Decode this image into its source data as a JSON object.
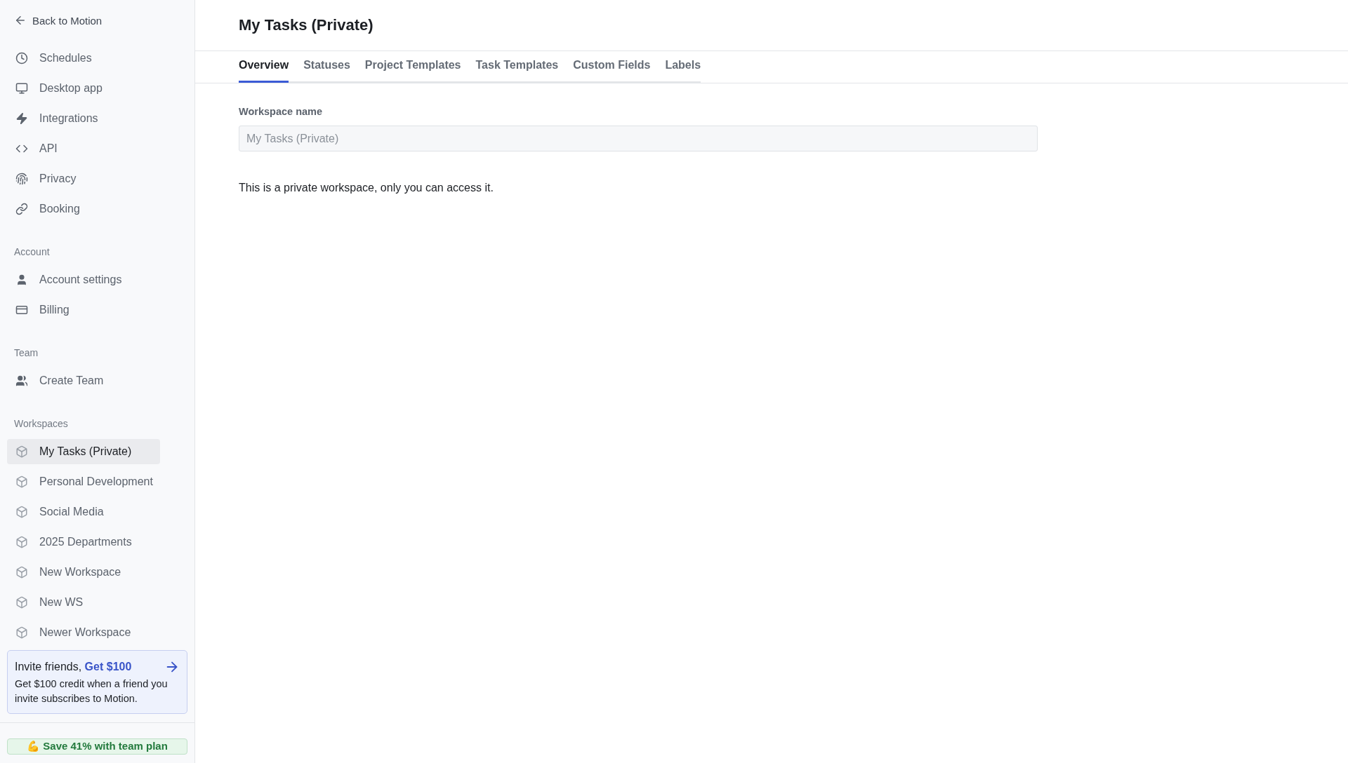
{
  "sidebar": {
    "back_link": "Back to Motion",
    "items": [
      {
        "label": "Schedules"
      },
      {
        "label": "Desktop app"
      },
      {
        "label": "Integrations"
      },
      {
        "label": "API"
      },
      {
        "label": "Privacy"
      },
      {
        "label": "Booking"
      }
    ],
    "sections": [
      {
        "title": "Account",
        "items": [
          {
            "label": "Account settings",
            "selected": false
          },
          {
            "label": "Billing",
            "selected": false
          }
        ]
      },
      {
        "title": "Team",
        "items": [
          {
            "label": "Create Team",
            "selected": false
          }
        ]
      },
      {
        "title": "Workspaces",
        "items": [
          {
            "label": "My Tasks (Private)",
            "selected": true
          },
          {
            "label": "Personal Development",
            "selected": false
          },
          {
            "label": "Social Media",
            "selected": false
          },
          {
            "label": "2025 Departments",
            "selected": false
          },
          {
            "label": "New Workspace",
            "selected": false
          },
          {
            "label": "New WS",
            "selected": false
          },
          {
            "label": "Newer Workspace",
            "selected": false
          }
        ]
      }
    ],
    "invite": {
      "title": "Invite friends, **Get $100**",
      "text": "Get $100 credit when a friend you invite subscribes to Motion."
    },
    "promo_button": "💪 Save 41% with team plan"
  },
  "main": {
    "title": "My Tasks (Private)",
    "tabs": [
      {
        "label": "Overview",
        "selected": true
      },
      {
        "label": "Statuses",
        "selected": false
      },
      {
        "label": "Project Templates",
        "selected": false
      },
      {
        "label": "Task Templates",
        "selected": false
      },
      {
        "label": "Custom Fields",
        "selected": false
      },
      {
        "label": "Labels",
        "selected": false
      }
    ],
    "field": {
      "label": "Workspace name",
      "placeholder": "My Tasks (Private)"
    },
    "note": "This is a private workspace, only you can access it."
  }
}
